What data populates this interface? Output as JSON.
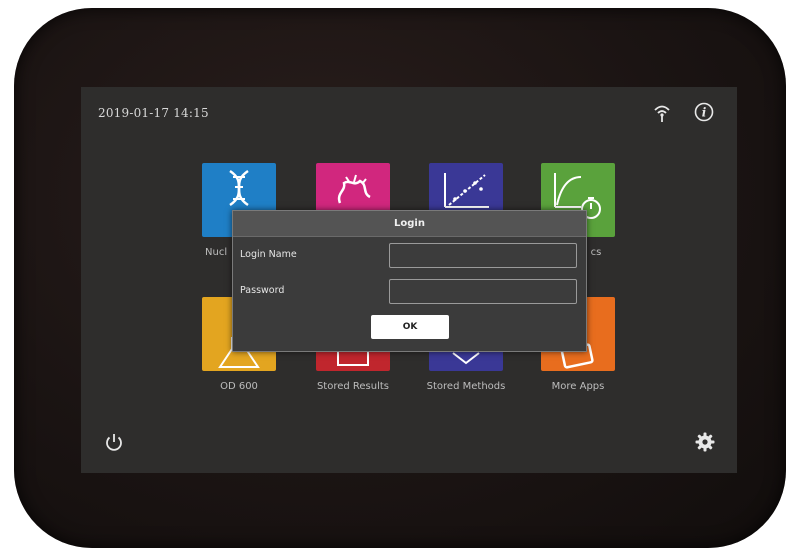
{
  "status_bar": {
    "datetime": "2019-01-17  14:15",
    "icons": [
      "wifi-icon",
      "info-icon"
    ]
  },
  "tiles": [
    {
      "id": "nucleic-acid",
      "label": "Nucl",
      "color": "#1f7fc6",
      "icon": "dna-icon"
    },
    {
      "id": "protein",
      "label": "",
      "color": "#d1277e",
      "icon": "protein-icon"
    },
    {
      "id": "standard-curve",
      "label": "",
      "color": "#3a3896",
      "icon": "scatter-plot-icon"
    },
    {
      "id": "kinetics",
      "label": "cs",
      "color": "#5aa23c",
      "icon": "kinetics-timer-icon"
    },
    {
      "id": "od600",
      "label": "OD 600",
      "color": "#e3a520",
      "icon": "flask-icon"
    },
    {
      "id": "stored-results",
      "label": "Stored Results",
      "color": "#c0262d",
      "icon": "results-icon"
    },
    {
      "id": "stored-methods",
      "label": "Stored Methods",
      "color": "#3a3896",
      "icon": "methods-icon"
    },
    {
      "id": "more-apps",
      "label": "More Apps",
      "color": "#e86d1e",
      "icon": "apps-icon"
    }
  ],
  "login_dialog": {
    "title": "Login",
    "login_name_label": "Login Name",
    "login_name_value": "",
    "password_label": "Password",
    "password_value": "",
    "ok_label": "OK"
  },
  "bottom_bar": {
    "icons": [
      "power-icon",
      "settings-gear-icon"
    ]
  },
  "colors": {
    "screen_bg": "#2e2d2c",
    "dialog_bg": "#3b3b3b",
    "dialog_header_bg": "#545454"
  }
}
